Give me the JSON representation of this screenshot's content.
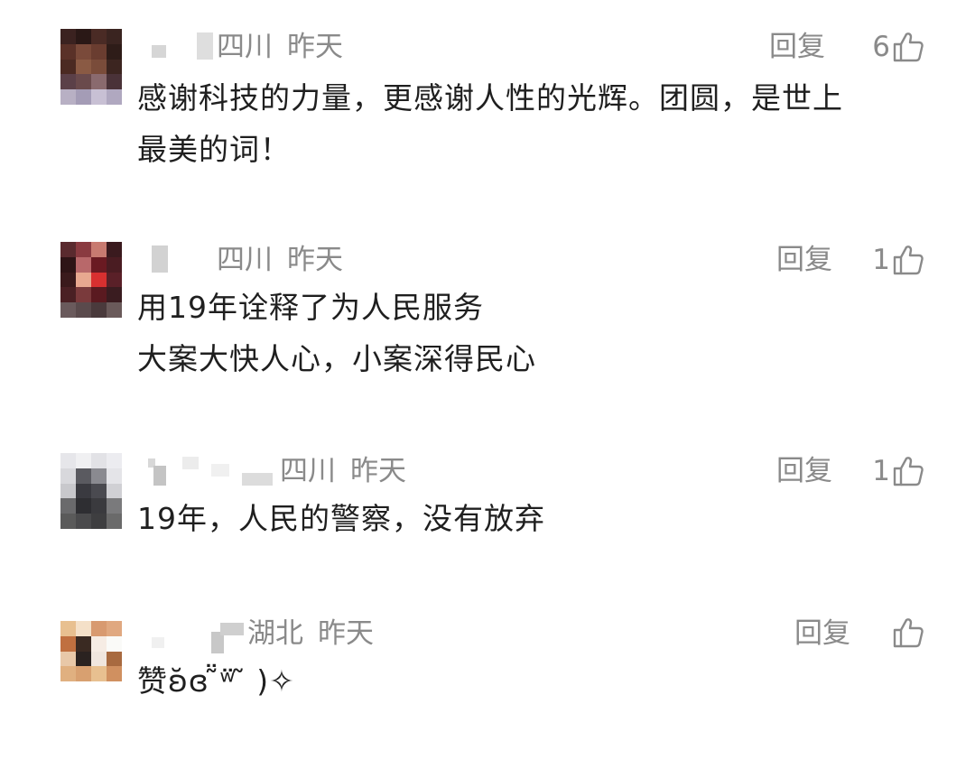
{
  "comments": [
    {
      "location": "四川",
      "time": "昨天",
      "reply_label": "回复",
      "like_count": "6",
      "text": "感谢科技的力量，更感谢人性的光辉。团圆，是世上\n最美的词！"
    },
    {
      "location": "四川",
      "time": "昨天",
      "reply_label": "回复",
      "like_count": "1",
      "text": "用19年诠释了为人民服务\n大案大快人心，小案深得民心"
    },
    {
      "location": "四川",
      "time": "昨天",
      "reply_label": "回复",
      "like_count": "1",
      "text": "19年，人民的警察，没有放弃"
    },
    {
      "location": "湖北",
      "time": "昨天",
      "reply_label": "回复",
      "like_count": "",
      "text": "赞ʚ̆ɞ ̃̈ʷ̈ ̃ )✧"
    }
  ],
  "icons": {
    "like": "thumbs-up-icon"
  },
  "colors": {
    "meta_text": "#8a8a8a",
    "body_text": "#1f1f1f"
  }
}
